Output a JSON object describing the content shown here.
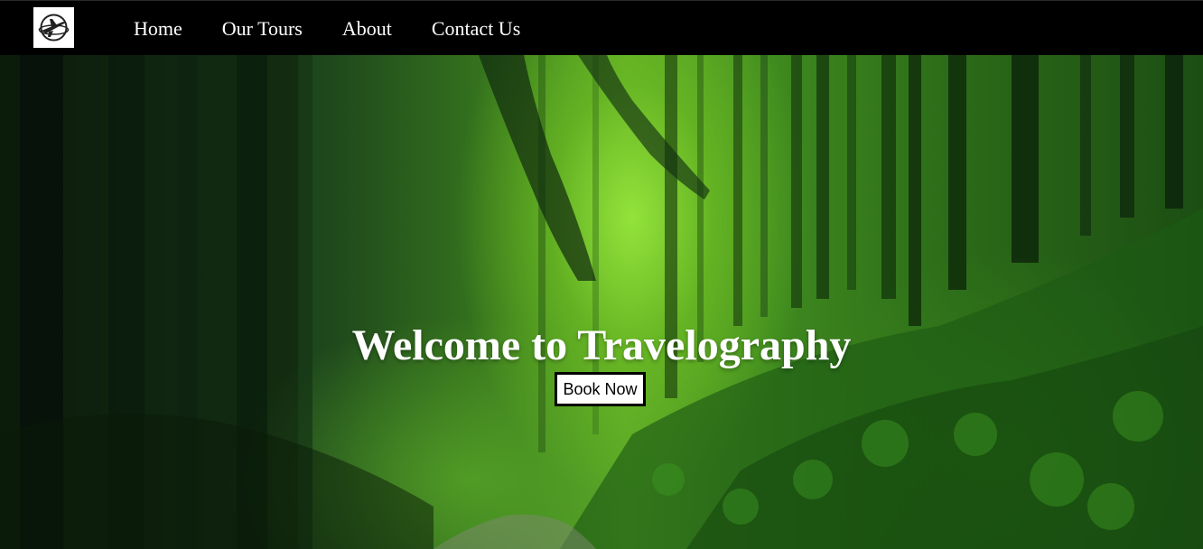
{
  "nav": {
    "logo_icon": "airplane-icon",
    "links": [
      {
        "label": "Home"
      },
      {
        "label": "Our Tours"
      },
      {
        "label": "About"
      },
      {
        "label": "Contact Us"
      }
    ]
  },
  "hero": {
    "title": "Welcome to Travelography",
    "button_label": "Book Now",
    "background": "green misty forest photo"
  },
  "colors": {
    "navbar": "#000000",
    "nav_text": "#ffffff",
    "hero_text": "#ffffff",
    "button_bg": "#ffffff",
    "button_border": "#000000"
  }
}
